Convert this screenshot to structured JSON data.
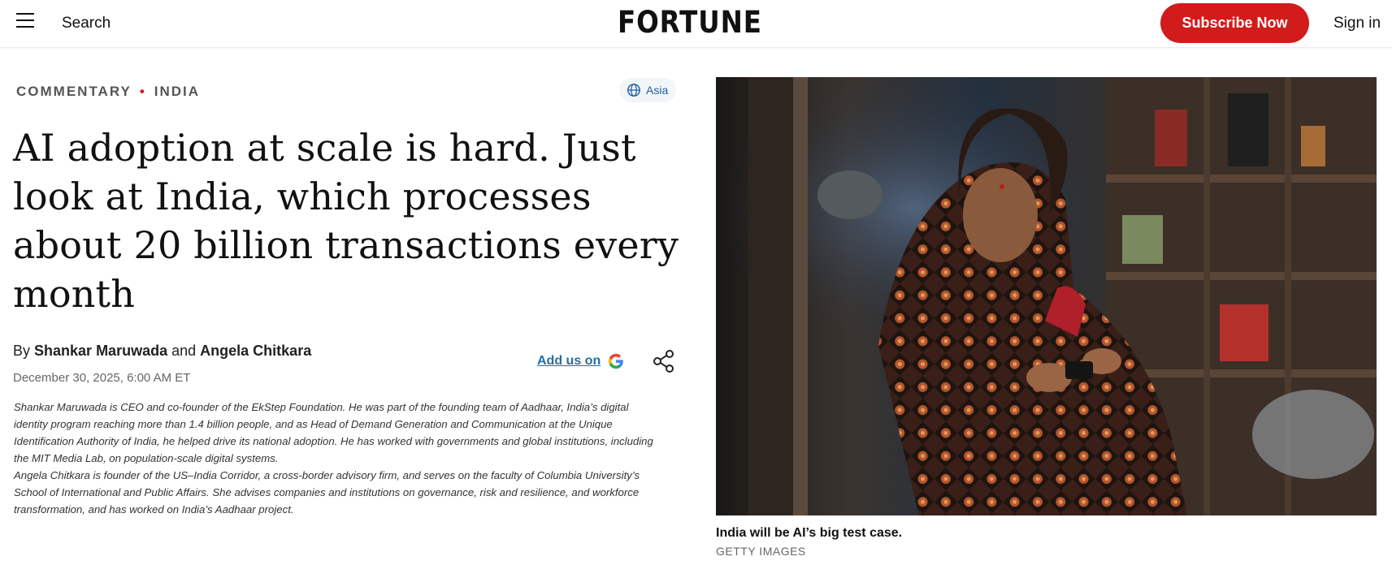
{
  "header": {
    "menu_icon": "hamburger-menu-icon",
    "search_label": "Search",
    "logo_text": "FORTUNE",
    "subscribe_label": "Subscribe Now",
    "signin_label": "Sign in",
    "accent_color": "#d21c1c"
  },
  "article": {
    "section": "COMMENTARY",
    "subsection": "INDIA",
    "region_tag": "Asia",
    "region_icon": "globe-icon",
    "headline": "AI adoption at scale is hard. Just look at India, which processes about 20 billion transactions every month",
    "byline_prefix": "By",
    "author1": "Shankar Maruwada",
    "byline_and": "and",
    "author2": "Angela Chitkara",
    "date": "December 30, 2025, 6:00 AM ET",
    "add_us_label": "Add us on",
    "google_icon": "google-g-icon",
    "share_icon": "share-icon",
    "bio1": "Shankar Maruwada is CEO and co-founder of the EkStep Foundation. He was part of the founding team of Aadhaar, India’s digital identity program reaching more than 1.4 billion people, and as Head of Demand Generation and Communication at the Unique Identification Authority of India, he helped drive its national adoption. He has worked with governments and global institutions, including the MIT Media Lab, on population-scale digital systems.",
    "bio2": "Angela Chitkara is founder of the US–India Corridor, a cross-border advisory firm, and serves on the faculty of Columbia University’s School of International and Public Affairs. She advises companies and institutions on governance, risk and resilience, and workforce transformation, and has worked on India’s Aadhaar project."
  },
  "image": {
    "caption": "India will be AI’s big test case.",
    "credit": "GETTY IMAGES"
  }
}
